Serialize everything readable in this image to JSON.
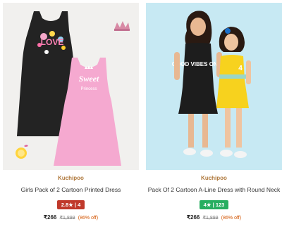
{
  "products": [
    {
      "brand": "Kuchipoo",
      "title": "Girls Pack of 2 Cartoon Printed Dress",
      "rating": "2.8★ | 4",
      "rating_color": "#c0392b",
      "price": "₹266",
      "mrp": "₹1,899",
      "discount": "(86% off)"
    },
    {
      "brand": "Kuchipoo",
      "title": "Pack Of 2 Cartoon A-Line Dress with Round Neck",
      "rating": "4★ | 123",
      "rating_color": "#27ae60",
      "price": "₹266",
      "mrp": "₹1,899",
      "discount": "(86% off)"
    }
  ],
  "dress_prints": {
    "black_love": "LOVE",
    "pink_sweet": "Sweet",
    "pink_sub": "Princess",
    "kid_black": "GOOD VIBES ONLY"
  }
}
